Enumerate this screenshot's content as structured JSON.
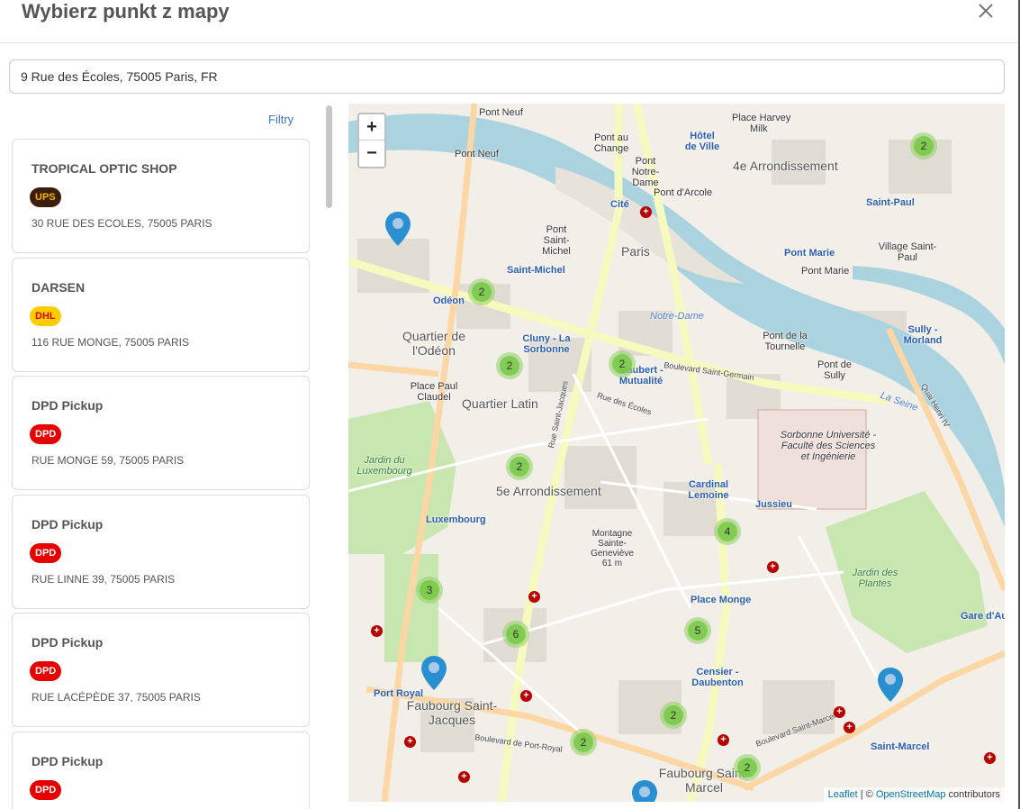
{
  "dialog": {
    "title": "Wybierz punkt z mapy"
  },
  "search": {
    "value": "9 Rue des Écoles, 75005 Paris, FR"
  },
  "filters": {
    "label": "Filtry"
  },
  "points": [
    {
      "name": "TROPICAL OPTIC SHOP",
      "carrier": "UPS",
      "address": "30 RUE DES ECOLES, 75005 PARIS"
    },
    {
      "name": "DARSEN",
      "carrier": "DHL",
      "address": "116 RUE MONGE, 75005 PARIS"
    },
    {
      "name": "DPD Pickup",
      "carrier": "DPD",
      "address": "RUE MONGE 59, 75005 PARIS"
    },
    {
      "name": "DPD Pickup",
      "carrier": "DPD",
      "address": "RUE LINNE 39, 75005 PARIS"
    },
    {
      "name": "DPD Pickup",
      "carrier": "DPD",
      "address": "RUE LACÉPÈDE 37, 75005 PARIS"
    },
    {
      "name": "DPD Pickup",
      "carrier": "DPD",
      "address": ""
    }
  ],
  "carrier_colors": {
    "UPS": {
      "bg": "#3b1f0c",
      "fg": "#f5b400"
    },
    "DHL": {
      "bg": "#ffcc00",
      "fg": "#d40511"
    },
    "DPD": {
      "bg": "#e60000",
      "fg": "#ffffff"
    }
  },
  "map": {
    "zoom_in": "+",
    "zoom_out": "−",
    "clusters": [
      "2",
      "2",
      "2",
      "2",
      "2",
      "4",
      "3",
      "6",
      "5",
      "2",
      "2",
      "2"
    ],
    "labels": {
      "pont_neuf": "Pont Neuf",
      "pont_neuf2": "Pont Neuf",
      "place_harvey": "Place Harvey",
      "milk": "Milk",
      "hotel_de_ville": "Hôtel de Ville",
      "arr4": "4e Arrondissement",
      "pont_au_change": "Pont au Change",
      "pont_notre_dame": "Pont Notre-Dame",
      "pont_arcole": "Pont d'Arcole",
      "saint_paul": "Saint-Paul",
      "village_saint_paul": "Village Saint-Paul",
      "cite": "Cité",
      "paris": "Paris",
      "pont_saint_michel": "Pont Saint-Michel",
      "saint_michel": "Saint-Michel",
      "odeon": "Odéon",
      "pont_marie": "Pont Marie",
      "pont_marie2": "Pont Marie",
      "sully_morland": "Sully - Morland",
      "notre_dame": "Notre-Dame",
      "quartier_odeon": "Quartier de l'Odéon",
      "cluny": "Cluny - La Sorbonne",
      "maubert": "Maubert - Mutualité",
      "pont_tournelle": "Pont de la Tournelle",
      "pont_sully": "Pont de Sully",
      "boulevard_st_germain": "Boulevard Saint-Germain",
      "place_paul_claudel": "Place Paul Claudel",
      "quartier_latin": "Quartier Latin",
      "la_seine": "La Seine",
      "jardin_lux": "Jardin du Luxembourg",
      "arr5": "5e Arrondissement",
      "sorbonne_univ": "Sorbonne Université - Faculté des Sciences et Ingénierie",
      "cardinal_lemoine": "Cardinal Lemoine",
      "jussieu": "Jussieu",
      "luxembourg": "Luxembourg",
      "montagne": "Montagne Sainte-Geneviève 61 m",
      "place_monge": "Place Monge",
      "jardin_plantes": "Jardin des Plantes",
      "port_royal": "Port Royal",
      "faubourg_sj": "Faubourg Saint-Jacques",
      "censier": "Censier - Daubenton",
      "bd_st_marcel": "Boulevard Saint-Marcel",
      "bd_port_royal": "Boulevard de Port-Royal",
      "faubourg_marcel": "Faubourg Saint-Marcel",
      "saint_marcel": "Saint-Marcel",
      "gare_austerlitz": "Gare d'Au",
      "rue_st_jacques": "Rue Saint-Jacques",
      "quai_henri": "Quai Henri IV",
      "rue_ecoles": "Rue des Écoles"
    },
    "attribution": {
      "leaflet": "Leaflet",
      "sep": " | © ",
      "osm": "OpenStreetMap",
      "suffix": " contributors"
    }
  }
}
